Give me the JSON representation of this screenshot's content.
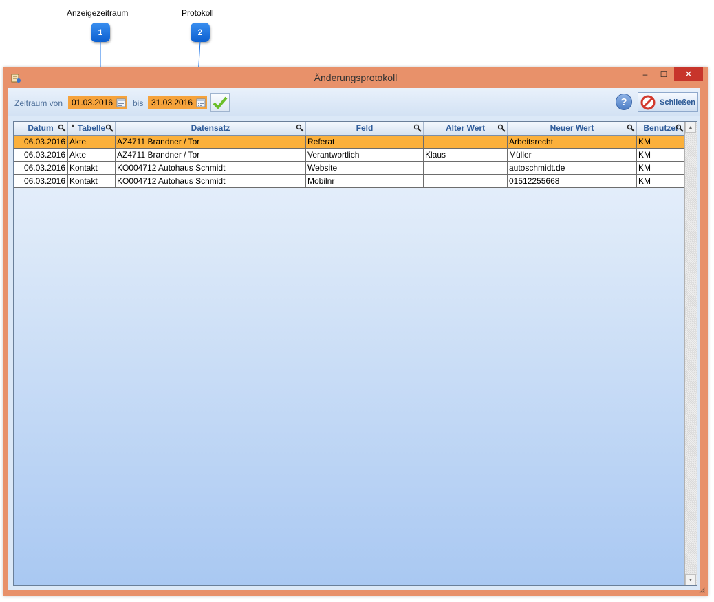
{
  "callouts": [
    {
      "number": "1",
      "label": "Anzeigezeitraum"
    },
    {
      "number": "2",
      "label": "Protokoll"
    }
  ],
  "window": {
    "title": "Änderungsprotokoll",
    "controls": {
      "minimize": "‒",
      "maximize": "☐",
      "close": "✕"
    }
  },
  "toolbar": {
    "zeitraum_label": "Zeitraum von",
    "date_from": "01.03.2016",
    "bis_label": "bis",
    "date_to": "31.03.2016",
    "help_label": "?",
    "close_label": "Schließen"
  },
  "grid": {
    "columns": [
      "Datum",
      "Tabelle",
      "Datensatz",
      "Feld",
      "Alter Wert",
      "Neuer Wert",
      "Benutzer"
    ],
    "sorted_column": "Tabelle",
    "rows": [
      {
        "datum": "06.03.2016",
        "tabelle": "Akte",
        "datensatz": "AZ4711 Brandner / Tor",
        "feld": "Referat",
        "alter_wert": "",
        "neuer_wert": "Arbeitsrecht",
        "benutzer": "KM",
        "selected": true
      },
      {
        "datum": "06.03.2016",
        "tabelle": "Akte",
        "datensatz": "AZ4711 Brandner / Tor",
        "feld": "Verantwortlich",
        "alter_wert": "Klaus",
        "neuer_wert": "Müller",
        "benutzer": "KM",
        "selected": false
      },
      {
        "datum": "06.03.2016",
        "tabelle": "Kontakt",
        "datensatz": "KO004712 Autohaus Schmidt",
        "feld": "Website",
        "alter_wert": "",
        "neuer_wert": "autoschmidt.de",
        "benutzer": "KM",
        "selected": false
      },
      {
        "datum": "06.03.2016",
        "tabelle": "Kontakt",
        "datensatz": "KO004712 Autohaus Schmidt",
        "feld": "Mobilnr",
        "alter_wert": "",
        "neuer_wert": "01512255668",
        "benutzer": "KM",
        "selected": false
      }
    ]
  },
  "colors": {
    "window_frame": "#e8916a",
    "selection": "#fbb03b",
    "date_field": "#f6a33c",
    "header_text": "#2f5c9a",
    "callout": "#1a73e8"
  }
}
